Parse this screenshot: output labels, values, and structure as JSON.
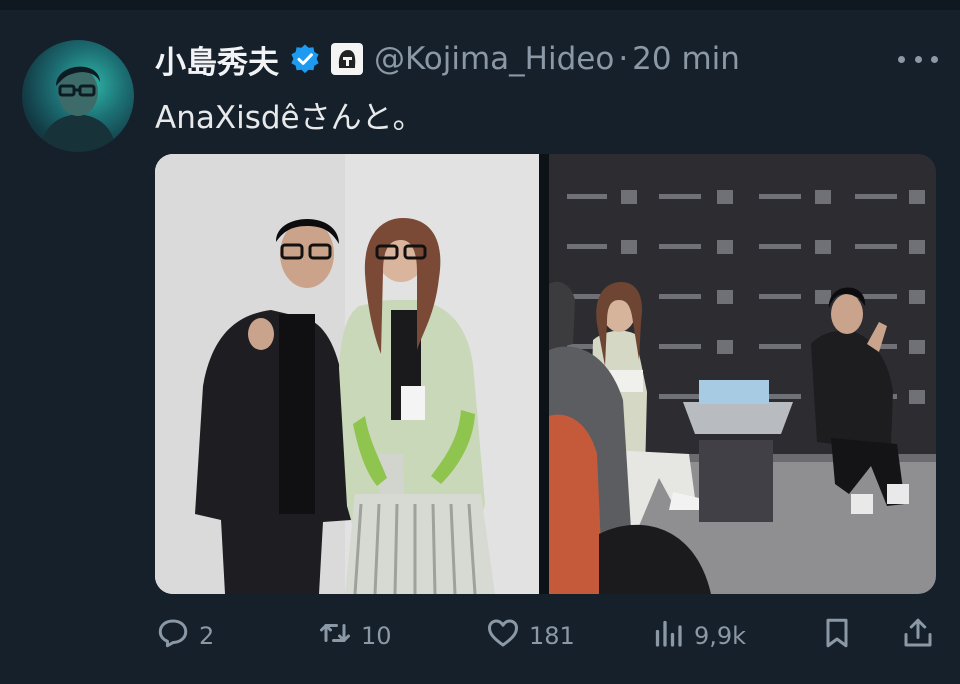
{
  "tweet": {
    "author_name": "小島秀夫",
    "handle": "@Kojima_Hideo",
    "separator": "·",
    "time": "20 min",
    "text": "AnaXisdêさんと。"
  },
  "actions": {
    "replies": "2",
    "retweets": "10",
    "likes": "181",
    "views": "9,9k"
  },
  "icons": {
    "verified": "verified-badge-icon",
    "affiliate": "helmet-affiliate-icon",
    "more": "more-dots-icon",
    "reply": "reply-icon",
    "retweet": "retweet-icon",
    "like": "heart-icon",
    "views": "views-icon",
    "bookmark": "bookmark-icon",
    "share": "share-icon"
  },
  "colors": {
    "background": "#15202b",
    "verified_blue": "#1d9bf0",
    "secondary_text": "#8b98a5"
  }
}
